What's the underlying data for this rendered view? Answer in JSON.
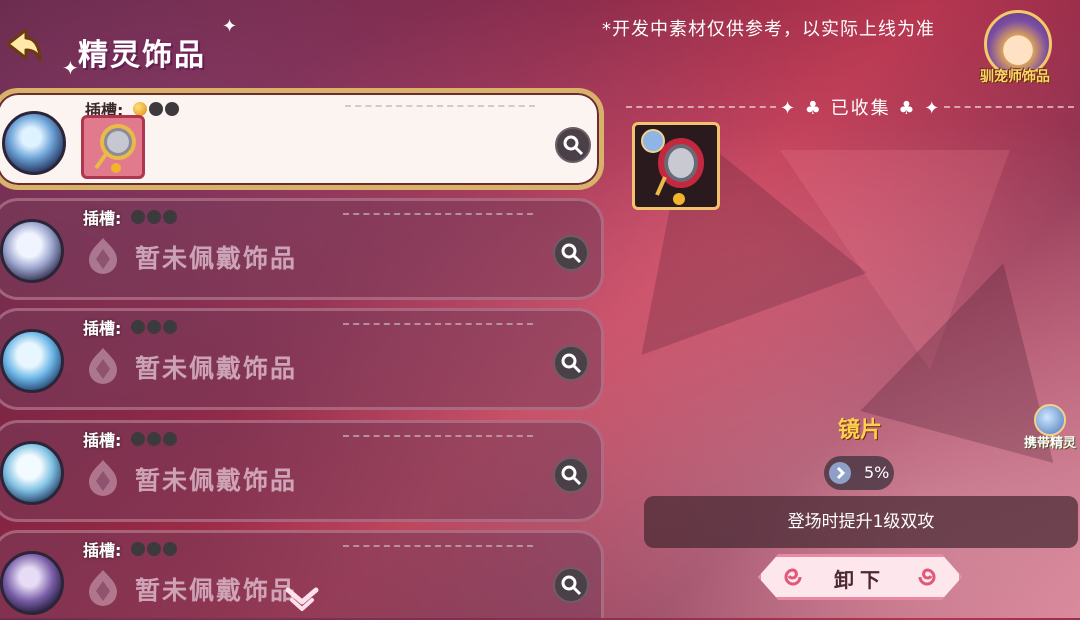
{
  "header": {
    "title": "精灵饰品",
    "notice": "*开发中素材仅供参考，以实际上线为准",
    "trainer_label": "驯宠师饰品"
  },
  "list": {
    "slot_label": "插槽:",
    "empty_text": "暂未佩戴饰品",
    "rows": [
      {
        "state": "equipped",
        "slots_filled": 1
      },
      {
        "state": "empty",
        "slots_filled": 0
      },
      {
        "state": "empty",
        "slots_filled": 0
      },
      {
        "state": "empty",
        "slots_filled": 0
      },
      {
        "state": "empty",
        "slots_filled": 0
      }
    ]
  },
  "collection": {
    "header": "已收集",
    "deco": "✦ ♣"
  },
  "detail": {
    "name": "镜片",
    "percent": "5%",
    "effect": "登场时提升1级双攻",
    "unequip_label": "卸下"
  },
  "carry": {
    "label": "携带精灵"
  },
  "colors": {
    "accent_gold": "#ffd050",
    "card_border": "#d8b16a",
    "button_bg": "#fde7ec"
  }
}
